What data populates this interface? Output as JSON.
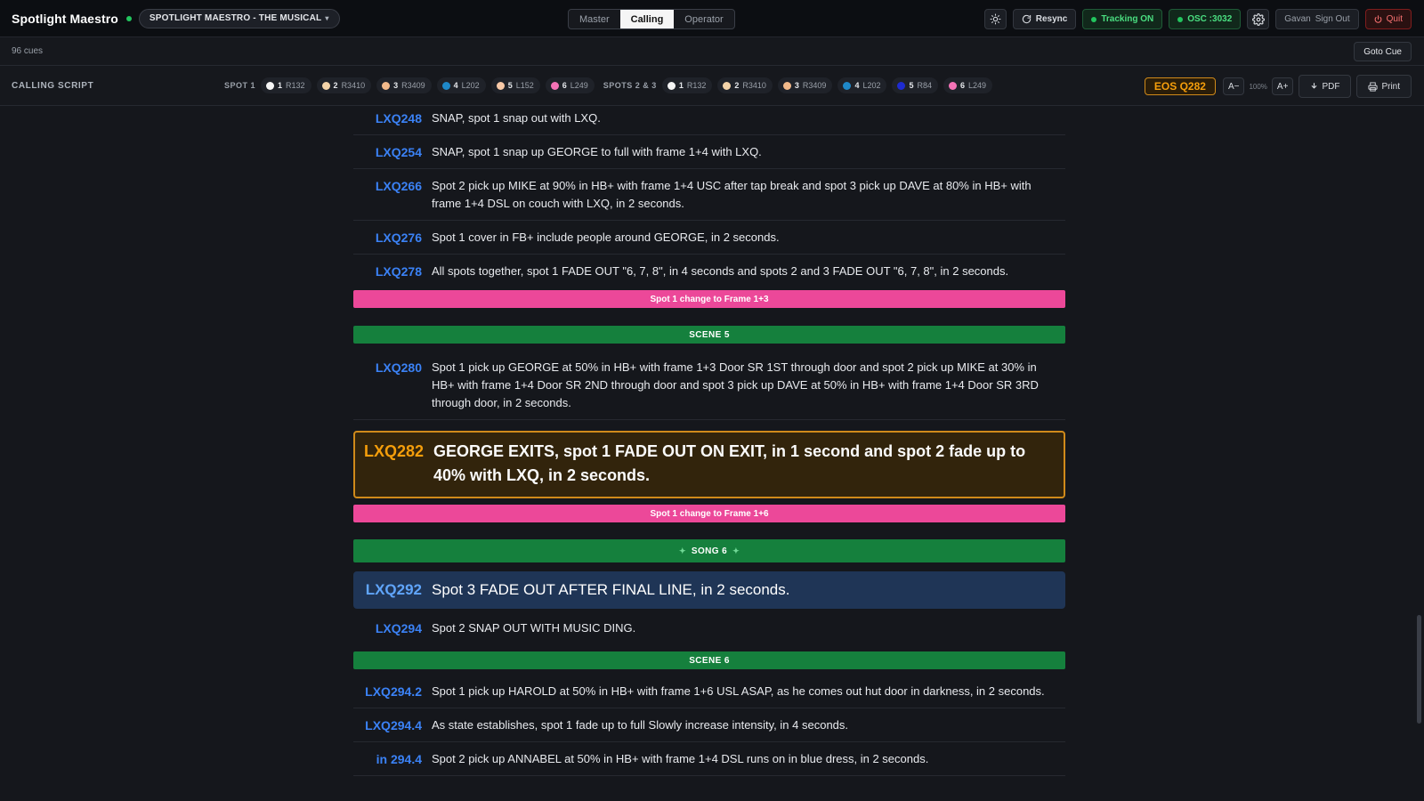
{
  "app": {
    "title": "Spotlight Maestro",
    "show_name": "SPOTLIGHT MAESTRO - THE MUSICAL",
    "modes": [
      "Master",
      "Calling",
      "Operator"
    ],
    "active_mode": "Calling",
    "resync_label": "Resync",
    "tracking_label": "Tracking ON",
    "osc_label": "OSC :3032",
    "user_name": "Gavan",
    "sign_out_label": "Sign Out",
    "quit_label": "Quit"
  },
  "status": {
    "cue_count": "96 cues",
    "goto_label": "Goto Cue"
  },
  "script_bar": {
    "title": "CALLING SCRIPT",
    "spot1_label": "SPOT 1",
    "spot1_chips": [
      {
        "num": "1",
        "code": "R132",
        "color": "#f5f5f5"
      },
      {
        "num": "2",
        "code": "R3410",
        "color": "#f3d3a8"
      },
      {
        "num": "3",
        "code": "R3409",
        "color": "#f2b98a"
      },
      {
        "num": "4",
        "code": "L202",
        "color": "#1e88c8"
      },
      {
        "num": "5",
        "code": "L152",
        "color": "#f8c9a7"
      },
      {
        "num": "6",
        "code": "L249",
        "color": "#f472b6"
      }
    ],
    "spots23_label": "SPOTS 2 & 3",
    "spots23_chips": [
      {
        "num": "1",
        "code": "R132",
        "color": "#f5f5f5"
      },
      {
        "num": "2",
        "code": "R3410",
        "color": "#f3d3a8"
      },
      {
        "num": "3",
        "code": "R3409",
        "color": "#f2b98a"
      },
      {
        "num": "4",
        "code": "L202",
        "color": "#1e88c8"
      },
      {
        "num": "5",
        "code": "R84",
        "color": "#1e2bd0"
      },
      {
        "num": "6",
        "code": "L249",
        "color": "#f472b6"
      }
    ],
    "eos_label": "EOS Q282",
    "font_minus": "A−",
    "zoom": "100%",
    "font_plus": "A+",
    "pdf_label": "PDF",
    "print_label": "Print"
  },
  "script": {
    "cue248": {
      "id": "LXQ248",
      "text": "SNAP, spot 1 snap out with LXQ."
    },
    "cue254": {
      "id": "LXQ254",
      "text": "SNAP, spot 1 snap up GEORGE to full with frame 1+4 with LXQ."
    },
    "cue266": {
      "id": "LXQ266",
      "text": "Spot 2 pick up MIKE at 90% in HB+ with frame 1+4 USC after tap break and spot 3 pick up DAVE at 80% in HB+ with frame 1+4 DSL on couch with LXQ, in 2 seconds."
    },
    "cue276": {
      "id": "LXQ276",
      "text": "Spot 1 cover in FB+ include people around GEORGE, in 2 seconds."
    },
    "cue278": {
      "id": "LXQ278",
      "text": "All spots together, spot 1 FADE OUT \"6, 7, 8\", in 4 seconds and spots 2 and 3 FADE OUT \"6, 7, 8\", in 2 seconds."
    },
    "banner_frame13": "Spot 1 change to Frame 1+3",
    "banner_scene5": "SCENE 5",
    "cue280": {
      "id": "LXQ280",
      "text": "Spot 1 pick up GEORGE at 50% in HB+ with frame 1+3 Door SR 1ST through door and spot 2 pick up MIKE at 30% in HB+ with frame 1+4 Door SR 2ND through door and spot 3 pick up DAVE at 50% in HB+ with frame 1+4 Door SR 3RD through door, in 2 seconds."
    },
    "cue282": {
      "id": "LXQ282",
      "text": "GEORGE EXITS, spot 1 FADE OUT ON EXIT, in 1 second and spot 2 fade up to 40% with LXQ, in 2 seconds."
    },
    "banner_frame16": "Spot 1 change to Frame 1+6",
    "banner_song6": "SONG 6",
    "cue292": {
      "id": "LXQ292",
      "text": "Spot 3 FADE OUT AFTER FINAL LINE, in 2 seconds."
    },
    "cue294": {
      "id": "LXQ294",
      "text": "Spot 2 SNAP OUT WITH MUSIC DING."
    },
    "banner_scene6": "SCENE 6",
    "cue2942": {
      "id": "LXQ294.2",
      "text": "Spot 1 pick up HAROLD at 50% in HB+ with frame 1+6 USL ASAP, as he comes out hut door in darkness, in 2 seconds."
    },
    "cue2944": {
      "id": "LXQ294.4",
      "text": "As state establishes, spot 1 fade up to full Slowly increase intensity, in 4 seconds."
    },
    "cuein2944": {
      "id": "in 294.4",
      "text": "Spot 2 pick up ANNABEL at 50% in HB+ with frame 1+4 DSL runs on in blue dress, in 2 seconds."
    }
  },
  "colors": {
    "cue_id": "#3b82f6",
    "current_border": "#d08a1a",
    "current_bg": "#32240c",
    "next_bg": "#1f3556",
    "banner_pink": "#ec4899",
    "banner_green": "#15803d"
  }
}
